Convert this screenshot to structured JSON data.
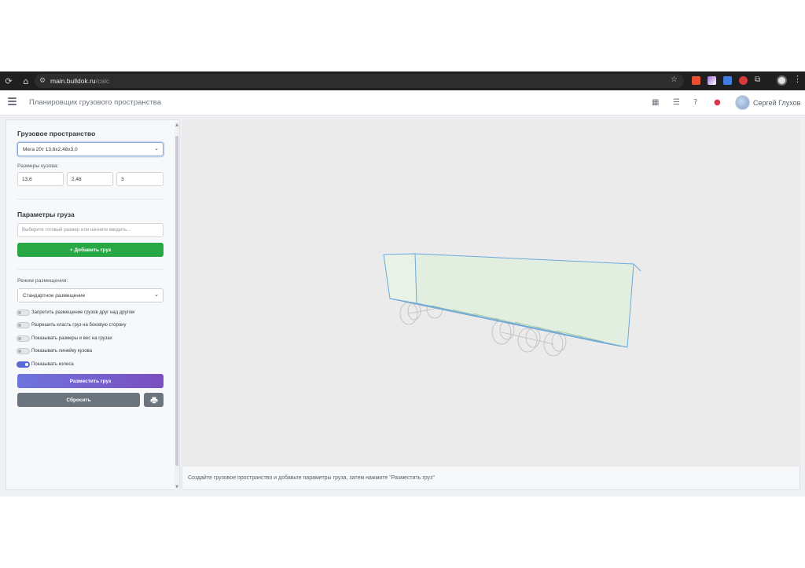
{
  "browser": {
    "url_host": "main.bulldok.ru",
    "url_path": "/calc"
  },
  "header": {
    "title": "Планировщик грузового пространства",
    "user_name": "Сергей Глухов"
  },
  "sidebar": {
    "space_section_title": "Грузовое пространство",
    "space_select_value": "Мега 20т 13,6х2,48х3,0",
    "body_dims_label": "Размеры кузова:",
    "dims": {
      "length": "13,6",
      "width": "2,48",
      "height": "3"
    },
    "cargo_section_title": "Параметры груза",
    "cargo_search_placeholder": "Выберите готовый размер или начните вводить...",
    "add_cargo_label": "+ Добавить груз",
    "placement_mode_label": "Режим размещения:",
    "placement_mode_value": "Стандартное размещение",
    "toggles": [
      {
        "label": "Запретить размещение грузов друг над другом",
        "on": false
      },
      {
        "label": "Разрешить класть груз на боковую сторону",
        "on": false
      },
      {
        "label": "Показывать размеры и вес на грузах",
        "on": false
      },
      {
        "label": "Показывать линейку кузова",
        "on": false
      },
      {
        "label": "Показывать колеса",
        "on": true
      }
    ],
    "place_button_label": "Разместить груз",
    "reset_button_label": "Сбросить"
  },
  "status": {
    "text": "Создайте грузовое пространство и добавьте параметры груза, затем нажмите \"Разместить груз\""
  },
  "colors": {
    "accent_green": "#28a745",
    "accent_purple_start": "#6f74dd",
    "accent_purple_end": "#7a4fc0",
    "secondary_gray": "#6c757d",
    "notification_red": "#dc3545",
    "box_edge_blue": "#6fa8dc",
    "box_fill_green": "#e2efe0"
  },
  "icons": {
    "reload": "reload-icon",
    "home": "home-icon",
    "site_settings": "tune-icon",
    "bookmark": "star-icon",
    "menu": "hamburger-icon",
    "calculator": "calculator-icon",
    "list": "list-icon",
    "help": "help-icon",
    "notifications": "bell-icon",
    "print": "print-icon"
  }
}
